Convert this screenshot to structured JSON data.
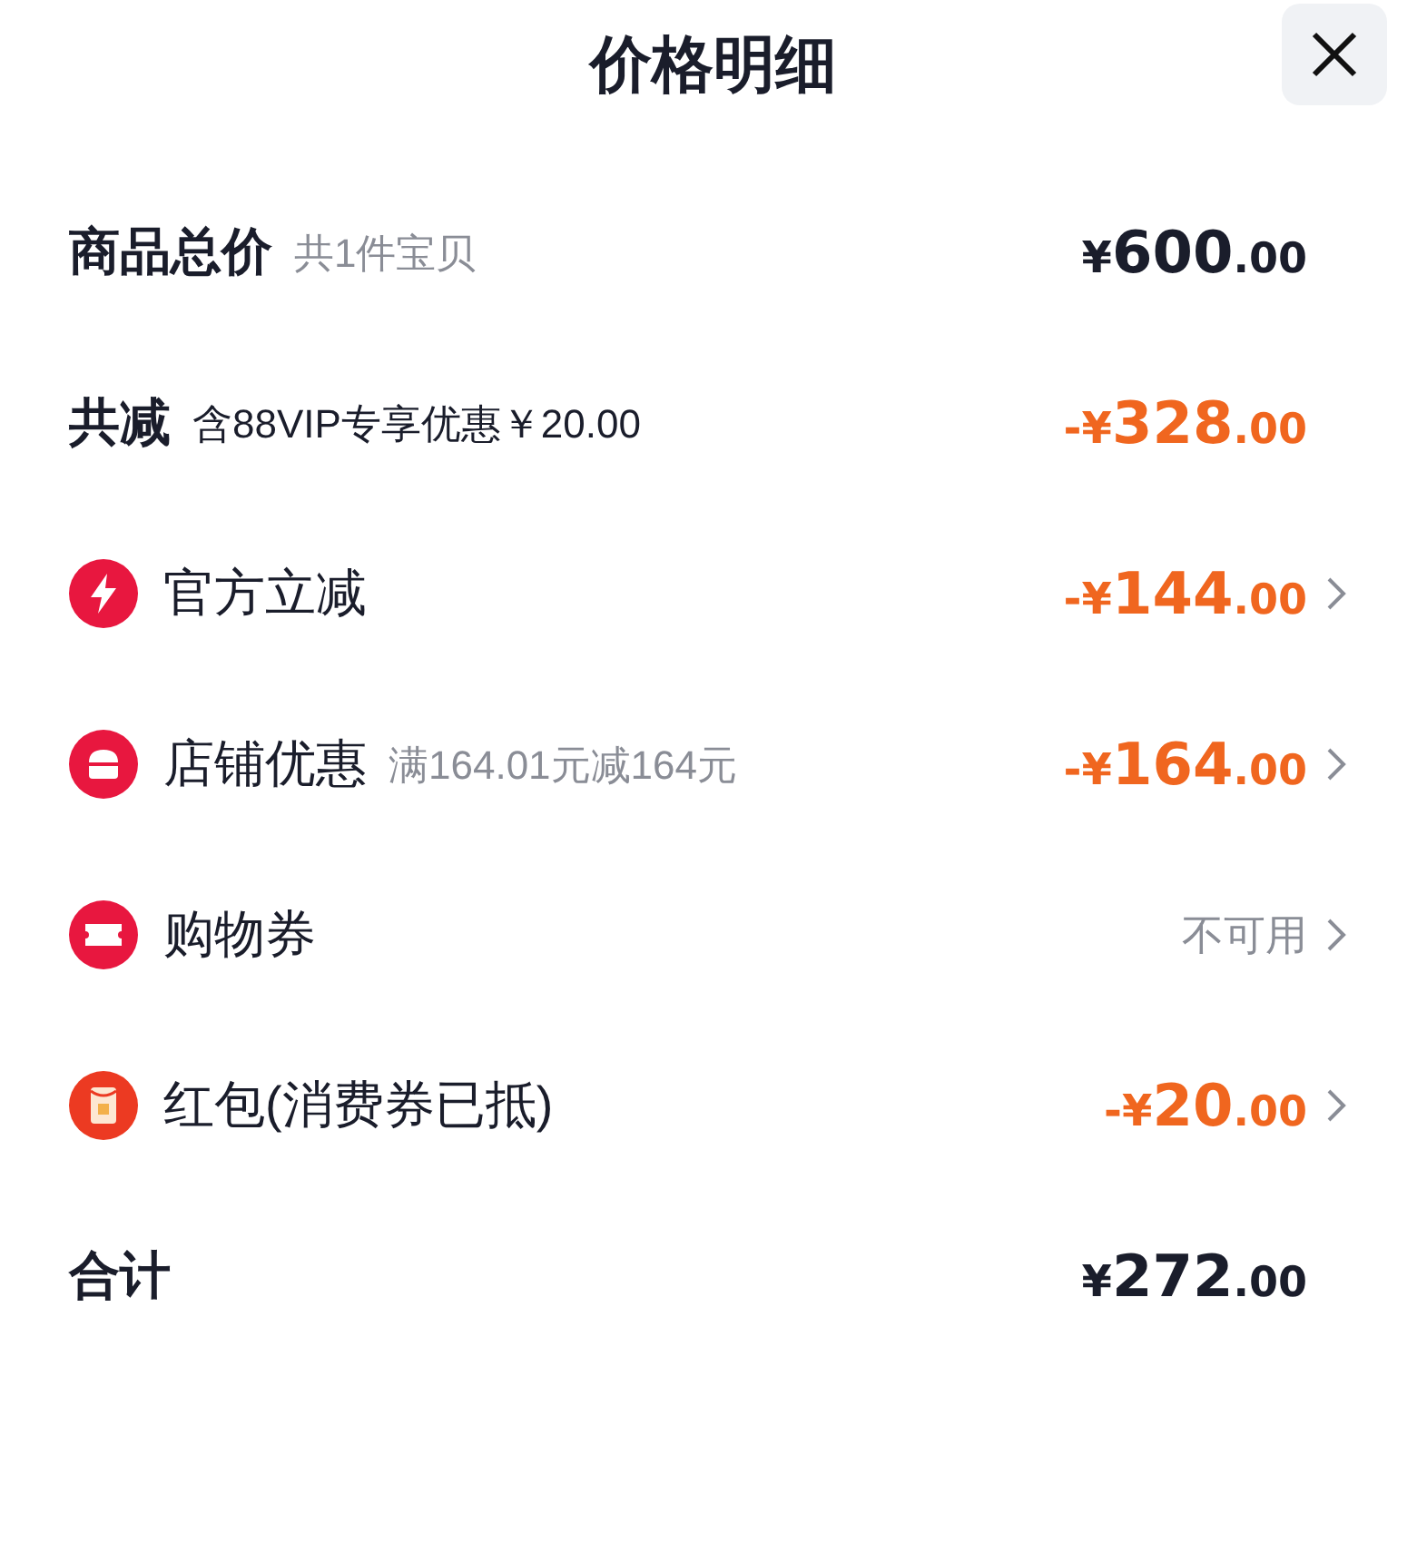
{
  "header": {
    "title": "价格明细"
  },
  "rows": [
    {
      "kind": "summary",
      "label": "商品总价",
      "note": "共1件宝贝",
      "amount": {
        "kind": "charge",
        "prefix": "¥",
        "main": "600",
        "cents": ".00"
      }
    },
    {
      "kind": "summary",
      "label": "共减",
      "note": "含88VIP专享优惠￥20.00",
      "amount": {
        "kind": "deduction",
        "prefix": "-¥",
        "main": "328",
        "cents": ".00"
      }
    },
    {
      "kind": "instant",
      "label": "官方立减",
      "amount": {
        "kind": "deduction",
        "prefix": "-¥",
        "main": "144",
        "cents": ".00"
      }
    },
    {
      "kind": "shop",
      "label": "店铺优惠",
      "note": "满164.01元减164元",
      "amount": {
        "kind": "deduction",
        "prefix": "-¥",
        "main": "164",
        "cents": ".00"
      }
    },
    {
      "kind": "coupon",
      "label": "购物券",
      "status": "不可用"
    },
    {
      "kind": "packet",
      "label": "红包(消费券已抵)",
      "amount": {
        "kind": "deduction",
        "prefix": "-¥",
        "main": "20",
        "cents": ".00"
      }
    },
    {
      "kind": "total",
      "label": "合计",
      "amount": {
        "kind": "charge",
        "prefix": "¥",
        "main": "272",
        "cents": ".00"
      }
    }
  ]
}
